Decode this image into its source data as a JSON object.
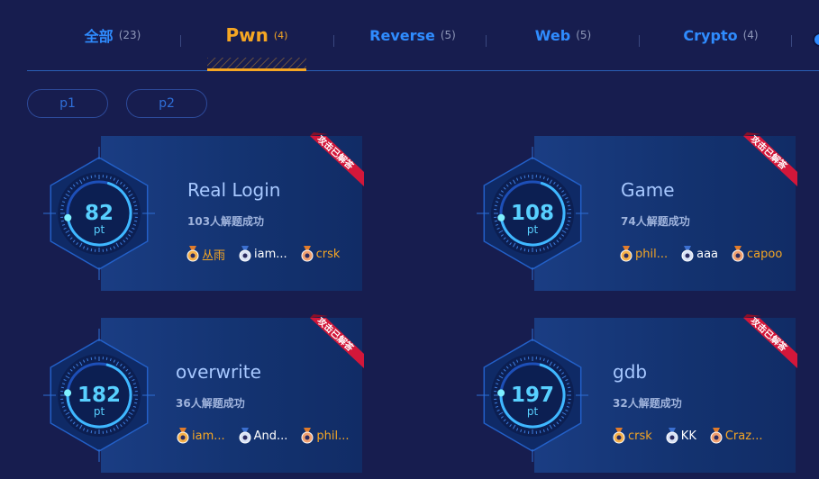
{
  "tabs": [
    {
      "label": "全部",
      "count": "(23)"
    },
    {
      "label": "Pwn",
      "count": "(4)"
    },
    {
      "label": "Reverse",
      "count": "(5)"
    },
    {
      "label": "Web",
      "count": "(5)"
    },
    {
      "label": "Crypto",
      "count": "(4)"
    }
  ],
  "filters": [
    "p1",
    "p2"
  ],
  "ribbon_text": "攻击已解答",
  "points_unit": "pt",
  "challenges": [
    {
      "title": "Real Login",
      "points": "82",
      "progress": 0.32,
      "solved": "103人解题成功",
      "solvers": [
        {
          "name": "丛雨",
          "medal": "gold"
        },
        {
          "name": "iam...",
          "medal": "silver"
        },
        {
          "name": "crsk",
          "medal": "bronze"
        }
      ]
    },
    {
      "title": "Game",
      "points": "108",
      "progress": 0.32,
      "solved": "74人解题成功",
      "solvers": [
        {
          "name": "phil...",
          "medal": "gold"
        },
        {
          "name": "aaa",
          "medal": "silver"
        },
        {
          "name": "capoo",
          "medal": "bronze"
        }
      ]
    },
    {
      "title": "overwrite",
      "points": "182",
      "progress": 0.28,
      "solved": "36人解题成功",
      "solvers": [
        {
          "name": "iam...",
          "medal": "gold"
        },
        {
          "name": "And...",
          "medal": "silver"
        },
        {
          "name": "phil...",
          "medal": "bronze"
        }
      ]
    },
    {
      "title": "gdb",
      "points": "197",
      "progress": 0.28,
      "solved": "32人解题成功",
      "solvers": [
        {
          "name": "crsk",
          "medal": "gold"
        },
        {
          "name": "KK",
          "medal": "silver"
        },
        {
          "name": "Craz...",
          "medal": "bronze"
        }
      ]
    }
  ],
  "colors": {
    "background": "#171d4f",
    "accent_active": "#f5a623",
    "tab_blue": "#2f8cff",
    "card": "#163574",
    "score": "#58d0ff",
    "ribbon": "#d3173a"
  }
}
